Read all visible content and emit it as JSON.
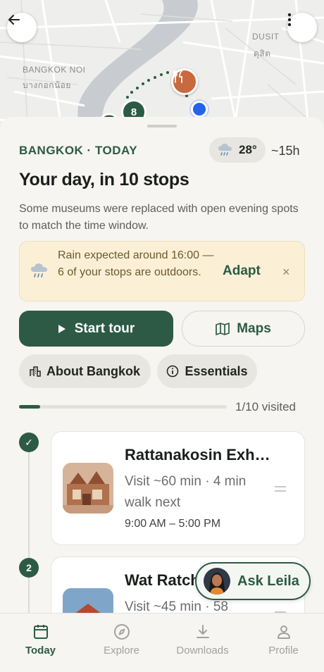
{
  "map": {
    "labels": {
      "bangkok_noi": "BANGKOK NOI",
      "bangkok_noi_thai": "บางกอกน้อย",
      "dusit": "DUSIT",
      "dusit_thai": "ดุสิต"
    },
    "stop_marker": "8"
  },
  "header": {
    "city": "BANGKOK · TODAY",
    "temperature": "28°",
    "duration": "~15h",
    "title": "Your day, in 10 stops",
    "subtitle": "Some museums were replaced with open evening spots to match the time window."
  },
  "alert": {
    "text": "Rain expected around 16:00 — 6 of your stops are outdoors.",
    "action": "Adapt",
    "close": "×"
  },
  "actions": {
    "start_tour": "Start tour",
    "maps": "Maps",
    "about": "About Bangkok",
    "essentials": "Essentials"
  },
  "progress": {
    "label": "1/10 visited",
    "fraction": 0.1
  },
  "stops": [
    {
      "marker": "✓",
      "name": "Rattanakosin Exh…",
      "meta": "Visit ~60 min · 4 min walk next",
      "hours": "9:00 AM – 5:00 PM"
    },
    {
      "marker": "2",
      "name": "Wat Ratch",
      "meta": "Visit ~45 min · 58",
      "hours": ""
    }
  ],
  "assistant": {
    "label": "Ask Leila"
  },
  "nav": [
    {
      "label": "Today",
      "icon": "calendar-icon",
      "active": true
    },
    {
      "label": "Explore",
      "icon": "compass-icon",
      "active": false
    },
    {
      "label": "Downloads",
      "icon": "download-icon",
      "active": false
    },
    {
      "label": "Profile",
      "icon": "person-icon",
      "active": false
    }
  ],
  "colors": {
    "primary": "#2d5a45",
    "alert_bg": "#fbf0d6",
    "food_pin": "#c8693e",
    "location": "#2563eb"
  }
}
